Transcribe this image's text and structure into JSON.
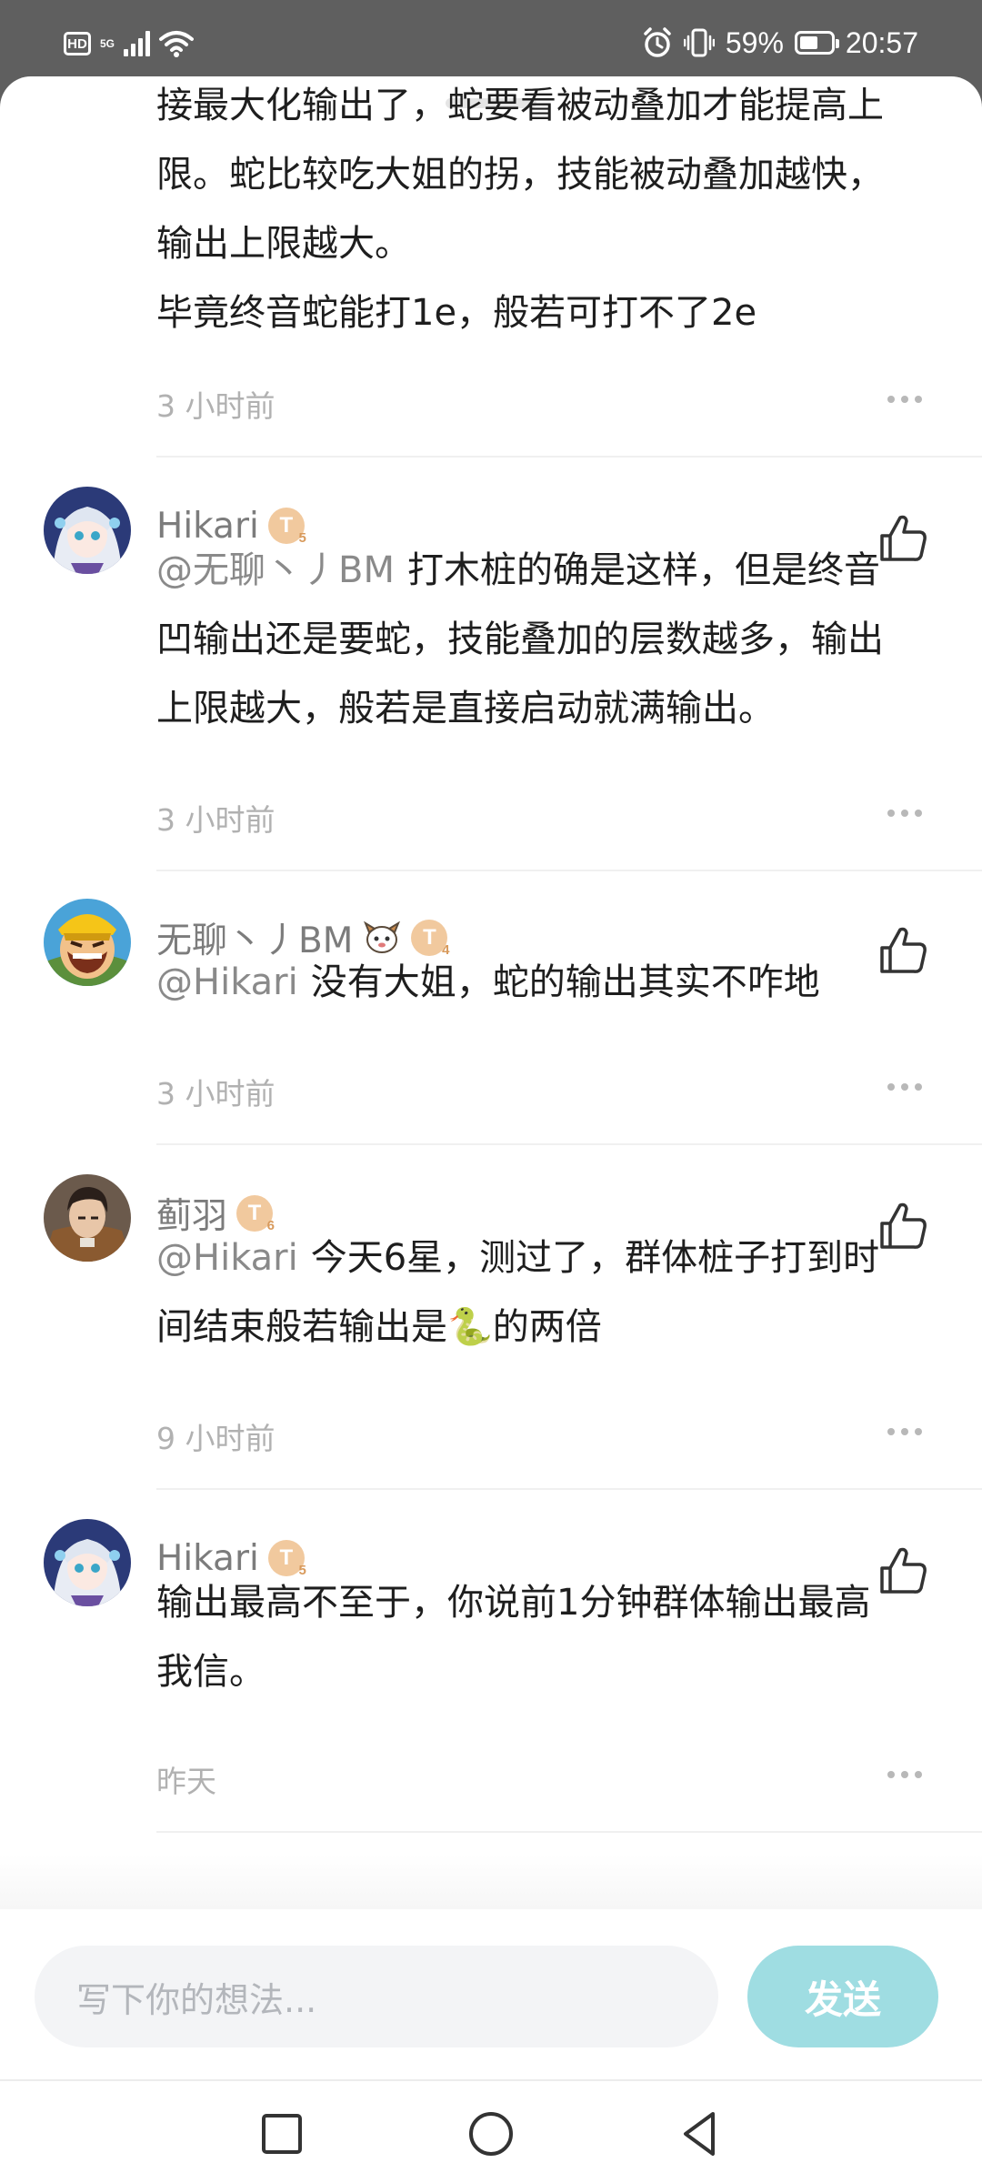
{
  "status_bar": {
    "hd": "HD",
    "network": "5G",
    "battery_percent": "59%",
    "battery_level": 0.59,
    "time": "20:57",
    "icons": [
      "hd-icon",
      "signal-icon",
      "wifi-icon",
      "alarm-icon",
      "vibrate-icon",
      "battery-icon"
    ]
  },
  "comments": [
    {
      "partial": true,
      "lines": [
        "接最大化输出了，蛇要看被动叠加才能提高上",
        "限。蛇比较吃大姐的拐，技能被动叠加越快，",
        "输出上限越大。",
        "毕竟终音蛇能打1e，般若可打不了2e"
      ],
      "time": "3 小时前"
    },
    {
      "username": "Hikari",
      "level": "T5",
      "mention": "@无聊丶丿BM",
      "lines": [
        "打木桩的确是这样，但是终音",
        "凹输出还是要蛇，技能叠加的层数越多，输出",
        "上限越大，般若是直接启动就满输出。"
      ],
      "time": "3 小时前"
    },
    {
      "username": "无聊丶丿BM",
      "level": "T4",
      "mention": "@Hikari",
      "lines": [
        "没有大姐，蛇的输出其实不咋地"
      ],
      "time": "3 小时前"
    },
    {
      "username": "蓟羽",
      "level": "T6",
      "mention": "@Hikari",
      "lines": [
        "今天6星，测过了，群体桩子打到时",
        "间结束般若输出是🐍的两倍"
      ],
      "time": "9 小时前"
    },
    {
      "username": "Hikari",
      "level": "T5",
      "mention": "",
      "lines": [
        "输出最高不至于，你说前1分钟群体输出最高",
        "我信。"
      ],
      "time": "昨天"
    }
  ],
  "input": {
    "placeholder": "写下你的想法...",
    "send_label": "发送"
  },
  "colors": {
    "send_button": "#9fdde2",
    "level_badge": "#f1c99e",
    "muted_text": "#b1b1b1"
  }
}
